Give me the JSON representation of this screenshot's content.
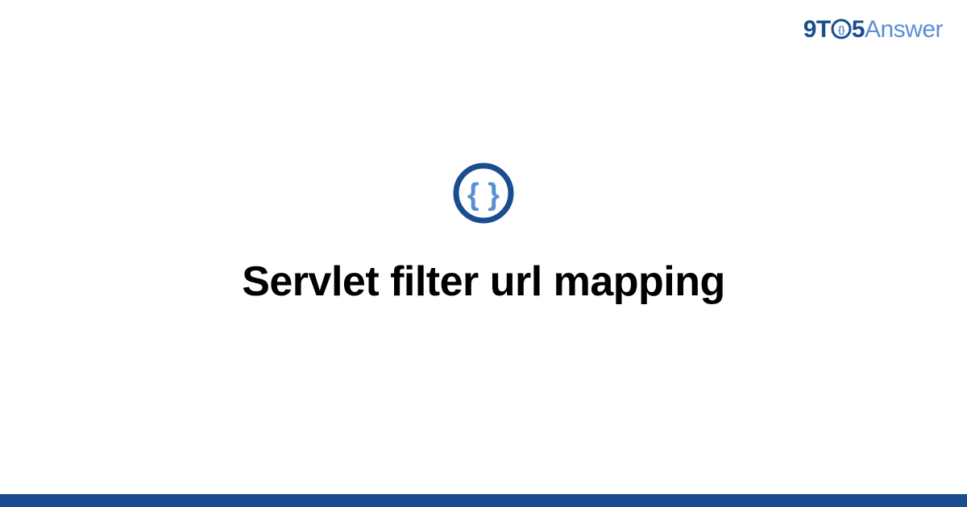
{
  "logo": {
    "part1": "9T",
    "part2": "5",
    "part3": "Answer"
  },
  "main": {
    "title": "Servlet filter url mapping"
  },
  "colors": {
    "primary": "#1a4d8f",
    "secondary": "#5a8fd4"
  }
}
